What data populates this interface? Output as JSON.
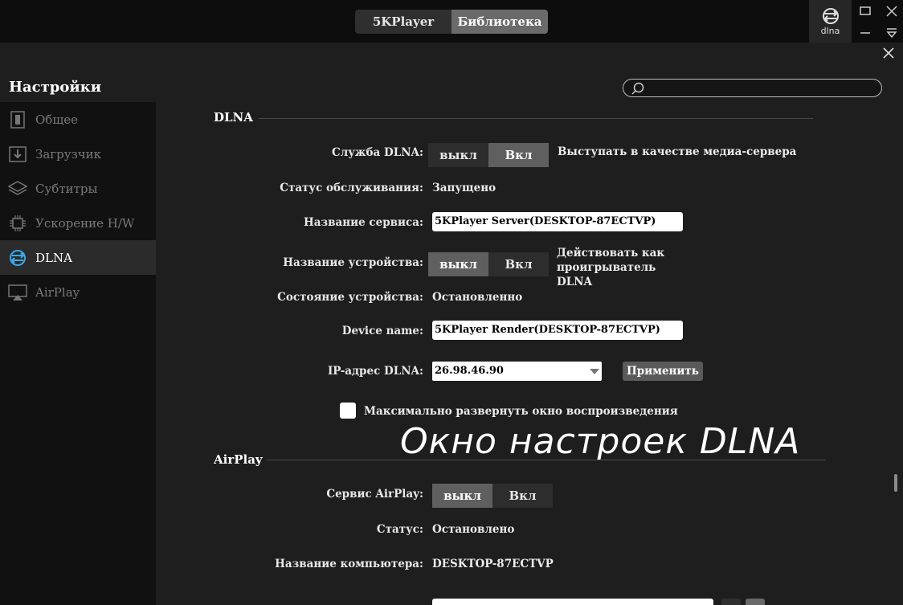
{
  "topbar": {
    "tab_player": "5KPlayer",
    "tab_library": "Библиотека",
    "dlna_label": "dlna"
  },
  "settings": {
    "title": "Настройки",
    "search_placeholder": ""
  },
  "sidebar": {
    "items": [
      {
        "label": "Общее",
        "icon": "general-icon"
      },
      {
        "label": "Загрузчик",
        "icon": "download-icon"
      },
      {
        "label": "Субтитры",
        "icon": "layers-icon"
      },
      {
        "label": "Ускорение H/W",
        "icon": "chip-icon"
      },
      {
        "label": "DLNA",
        "icon": "dlna-icon",
        "active": true
      },
      {
        "label": "AirPlay",
        "icon": "airplay-icon"
      }
    ]
  },
  "dlna": {
    "heading": "DLNA",
    "service_label": "Служба DLNA:",
    "service_off": "выкл",
    "service_on": "Вкл",
    "service_desc": "Выступать в качестве медиа-сервера",
    "status_label": "Статус обслуживания:",
    "status_value": "Запущено",
    "service_name_label": "Название сервиса:",
    "service_name_value": "5KPlayer Server(DESKTOP-87ECTVP)",
    "device_label": "Название устройства:",
    "device_off": "выкл",
    "device_on": "Вкл",
    "device_desc_line1": "Действовать как",
    "device_desc_line2": "проигрыватель",
    "device_desc_line3": "DLNA",
    "device_state_label": "Состояние устройства:",
    "device_state_value": "Остановленно",
    "device_name_label": "Device name:",
    "device_name_value": "5KPlayer Render(DESKTOP-87ECTVP)",
    "ip_label": "IP-адрес DLNA:",
    "ip_value": "26.98.46.90",
    "apply_label": "Применить",
    "maximize_label": "Максимально развернуть окно воспроизведения"
  },
  "overlay": {
    "caption": "Окно настроек DLNA"
  },
  "airplay": {
    "heading": "AirPlay",
    "service_label": "Сервис AirPlay:",
    "service_off": "выкл",
    "service_on": "Вкл",
    "status_label": "Статус:",
    "status_value": "Остановлено",
    "computer_label": "Название компьютера:",
    "computer_value": "DESKTOP-87ECTVP"
  }
}
